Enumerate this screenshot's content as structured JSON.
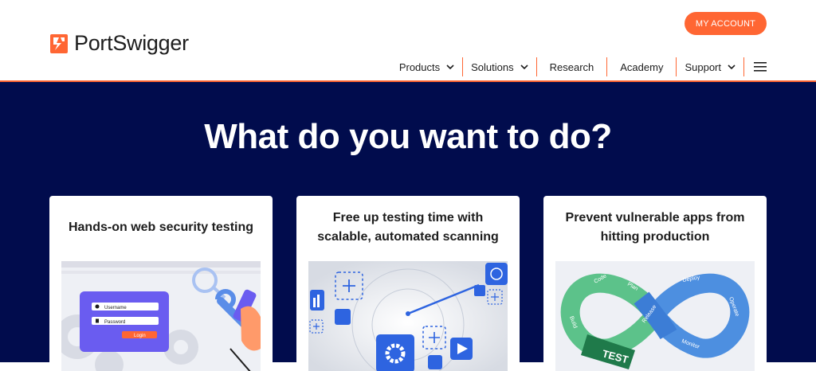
{
  "header": {
    "brand": "PortSwigger",
    "account_button": "MY ACCOUNT",
    "nav": [
      {
        "label": "Products"
      },
      {
        "label": "Solutions"
      },
      {
        "label": "Research"
      },
      {
        "label": "Academy"
      },
      {
        "label": "Support"
      }
    ]
  },
  "hero": {
    "title": "What do you want to do?"
  },
  "cards": [
    {
      "title": "Hands-on web security testing",
      "illustration": {
        "username_label": "Username",
        "password_label": "Password",
        "login_label": "Login"
      }
    },
    {
      "title": "Free up testing time with scalable, automated scanning"
    },
    {
      "title": "Prevent vulnerable apps from hitting production",
      "illustration": {
        "labels": [
          "Code",
          "Plan",
          "Release",
          "Deploy",
          "Operate",
          "Monitor",
          "Build"
        ],
        "center_label": "TEST"
      }
    }
  ],
  "colors": {
    "accent": "#ff6633",
    "hero_bg": "#010c4d",
    "card_bg": "#ffffff"
  }
}
